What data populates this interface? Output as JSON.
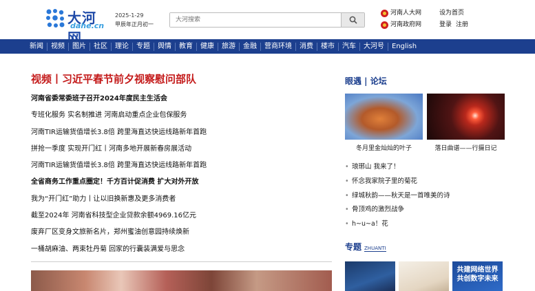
{
  "header": {
    "logo_cn": "大河网",
    "logo_en": "dahe.cn",
    "date": "2025-1-29",
    "lunar_date": "甲辰年正月初一",
    "search_placeholder": "大河搜索",
    "links_left": [
      "河南人大网",
      "河南政府网"
    ],
    "links_right_top": [
      "设为首页"
    ],
    "links_right_bottom": [
      "登录",
      "注册"
    ]
  },
  "nav": [
    "新闻",
    "视频",
    "图片",
    "社区",
    "理论",
    "专题",
    "舆情",
    "教育",
    "健康",
    "旅游",
    "金融",
    "营商环境",
    "消费",
    "楼市",
    "汽车",
    "大河号",
    "English"
  ],
  "main": {
    "headline": "视频丨习近平春节前夕视察慰问部队",
    "items": [
      {
        "text": "河南省委常委班子召开2024年度民主生活会",
        "bold": true
      },
      {
        "text": "专班化服务 实名制推进 河南启动重点企业包保服务",
        "bold": false
      },
      {
        "text": "河南TIR运输货值增长3.8倍 跨里海直达快运线路新年首跑",
        "bold": false
      },
      {
        "text": "拼抢一季度 实现开门红丨河南多地开展新春房展活动",
        "bold": false
      },
      {
        "text": "河南TIR运输货值增长3.8倍 跨里海直达快运线路新年首跑",
        "bold": false
      },
      {
        "text": "全省商务工作重点圈定！千方百计促消费 扩大对外开放",
        "bold": true
      },
      {
        "text": "我为“开门红”助力丨让以旧换新惠及更多消费者",
        "bold": false
      },
      {
        "text": "截至2024年 河南省科技型企业贷款余额4969.16亿元",
        "bold": false
      },
      {
        "text": "废弃厂区变身文旅新名片，郑州蜜油创意园持续焕新",
        "bold": false
      },
      {
        "text": "一桶胡麻油、两束牡丹菊 回家的行囊装满爱与思念",
        "bold": false
      }
    ]
  },
  "side": {
    "title": "眼遇 | 论坛",
    "thumbs": [
      {
        "caption": "冬月里金灿灿的叶子"
      },
      {
        "caption": "落日曲谱——行摄日记"
      }
    ],
    "list": [
      "琅琊山 我来了！",
      "怀念我家院子里的菊花",
      "绿城秋韵——秋天是一首唯美的诗",
      "骨顶鸡的激烈战争",
      "h~u~a！花"
    ],
    "zt_title": "专题",
    "zt_en": "ZHUANTI",
    "zt_banner_text": "共建网络世界\n共创数字未来"
  },
  "colors": {
    "brand_blue": "#1c3f8e",
    "headline_red": "#c41a1a"
  }
}
